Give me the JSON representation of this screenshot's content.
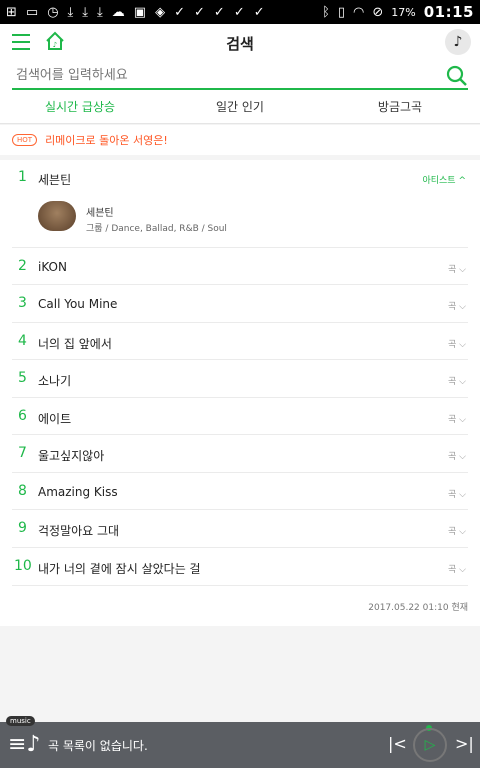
{
  "statusbar": {
    "time": "01:15",
    "battery": "17%",
    "left_icons": [
      "plus-box-icon",
      "cast-icon",
      "alarm-icon",
      "download-icon",
      "download-icon",
      "download-icon",
      "cloud-icon",
      "image-icon",
      "shield-icon",
      "check-icon",
      "check-icon",
      "check-icon",
      "check-icon",
      "check-icon"
    ],
    "right_icons": [
      "bluetooth-icon",
      "vibrate-icon",
      "wifi-icon",
      "no-disturb-icon"
    ]
  },
  "header": {
    "title": "검색"
  },
  "search": {
    "placeholder": "검색어를 입력하세요"
  },
  "tabs": [
    {
      "label": "실시간 급상승",
      "active": true
    },
    {
      "label": "일간 인기",
      "active": false
    },
    {
      "label": "방금그곡",
      "active": false
    }
  ],
  "hot": {
    "badge": "HOT",
    "text": "리메이크로 돌아온 서영은!"
  },
  "list": [
    {
      "rank": "1",
      "title": "세븐틴",
      "meta": "아티스트 ^",
      "artist": {
        "name": "세븐틴",
        "genre": "그룹 / Dance, Ballad, R&B / Soul"
      }
    },
    {
      "rank": "2",
      "title": "iKON",
      "meta": "곡 ⌵"
    },
    {
      "rank": "3",
      "title": "Call You Mine",
      "meta": "곡 ⌵"
    },
    {
      "rank": "4",
      "title": "너의 집 앞에서",
      "meta": "곡 ⌵"
    },
    {
      "rank": "5",
      "title": "소나기",
      "meta": "곡 ⌵"
    },
    {
      "rank": "6",
      "title": "에이트",
      "meta": "곡 ⌵"
    },
    {
      "rank": "7",
      "title": "울고싶지않아",
      "meta": "곡 ⌵"
    },
    {
      "rank": "8",
      "title": "Amazing Kiss",
      "meta": "곡 ⌵"
    },
    {
      "rank": "9",
      "title": "걱정말아요 그대",
      "meta": "곡 ⌵"
    },
    {
      "rank": "10",
      "title": "내가 너의 곁에 잠시 살았다는 걸",
      "meta": "곡 ⌵"
    }
  ],
  "timestamp": "2017.05.22 01:10 현재",
  "player": {
    "tag": "music",
    "text": "곡 목록이 없습니다."
  },
  "colors": {
    "accent": "#1fb84a",
    "hot": "#ff5522",
    "player_bg": "#5b5e63"
  }
}
